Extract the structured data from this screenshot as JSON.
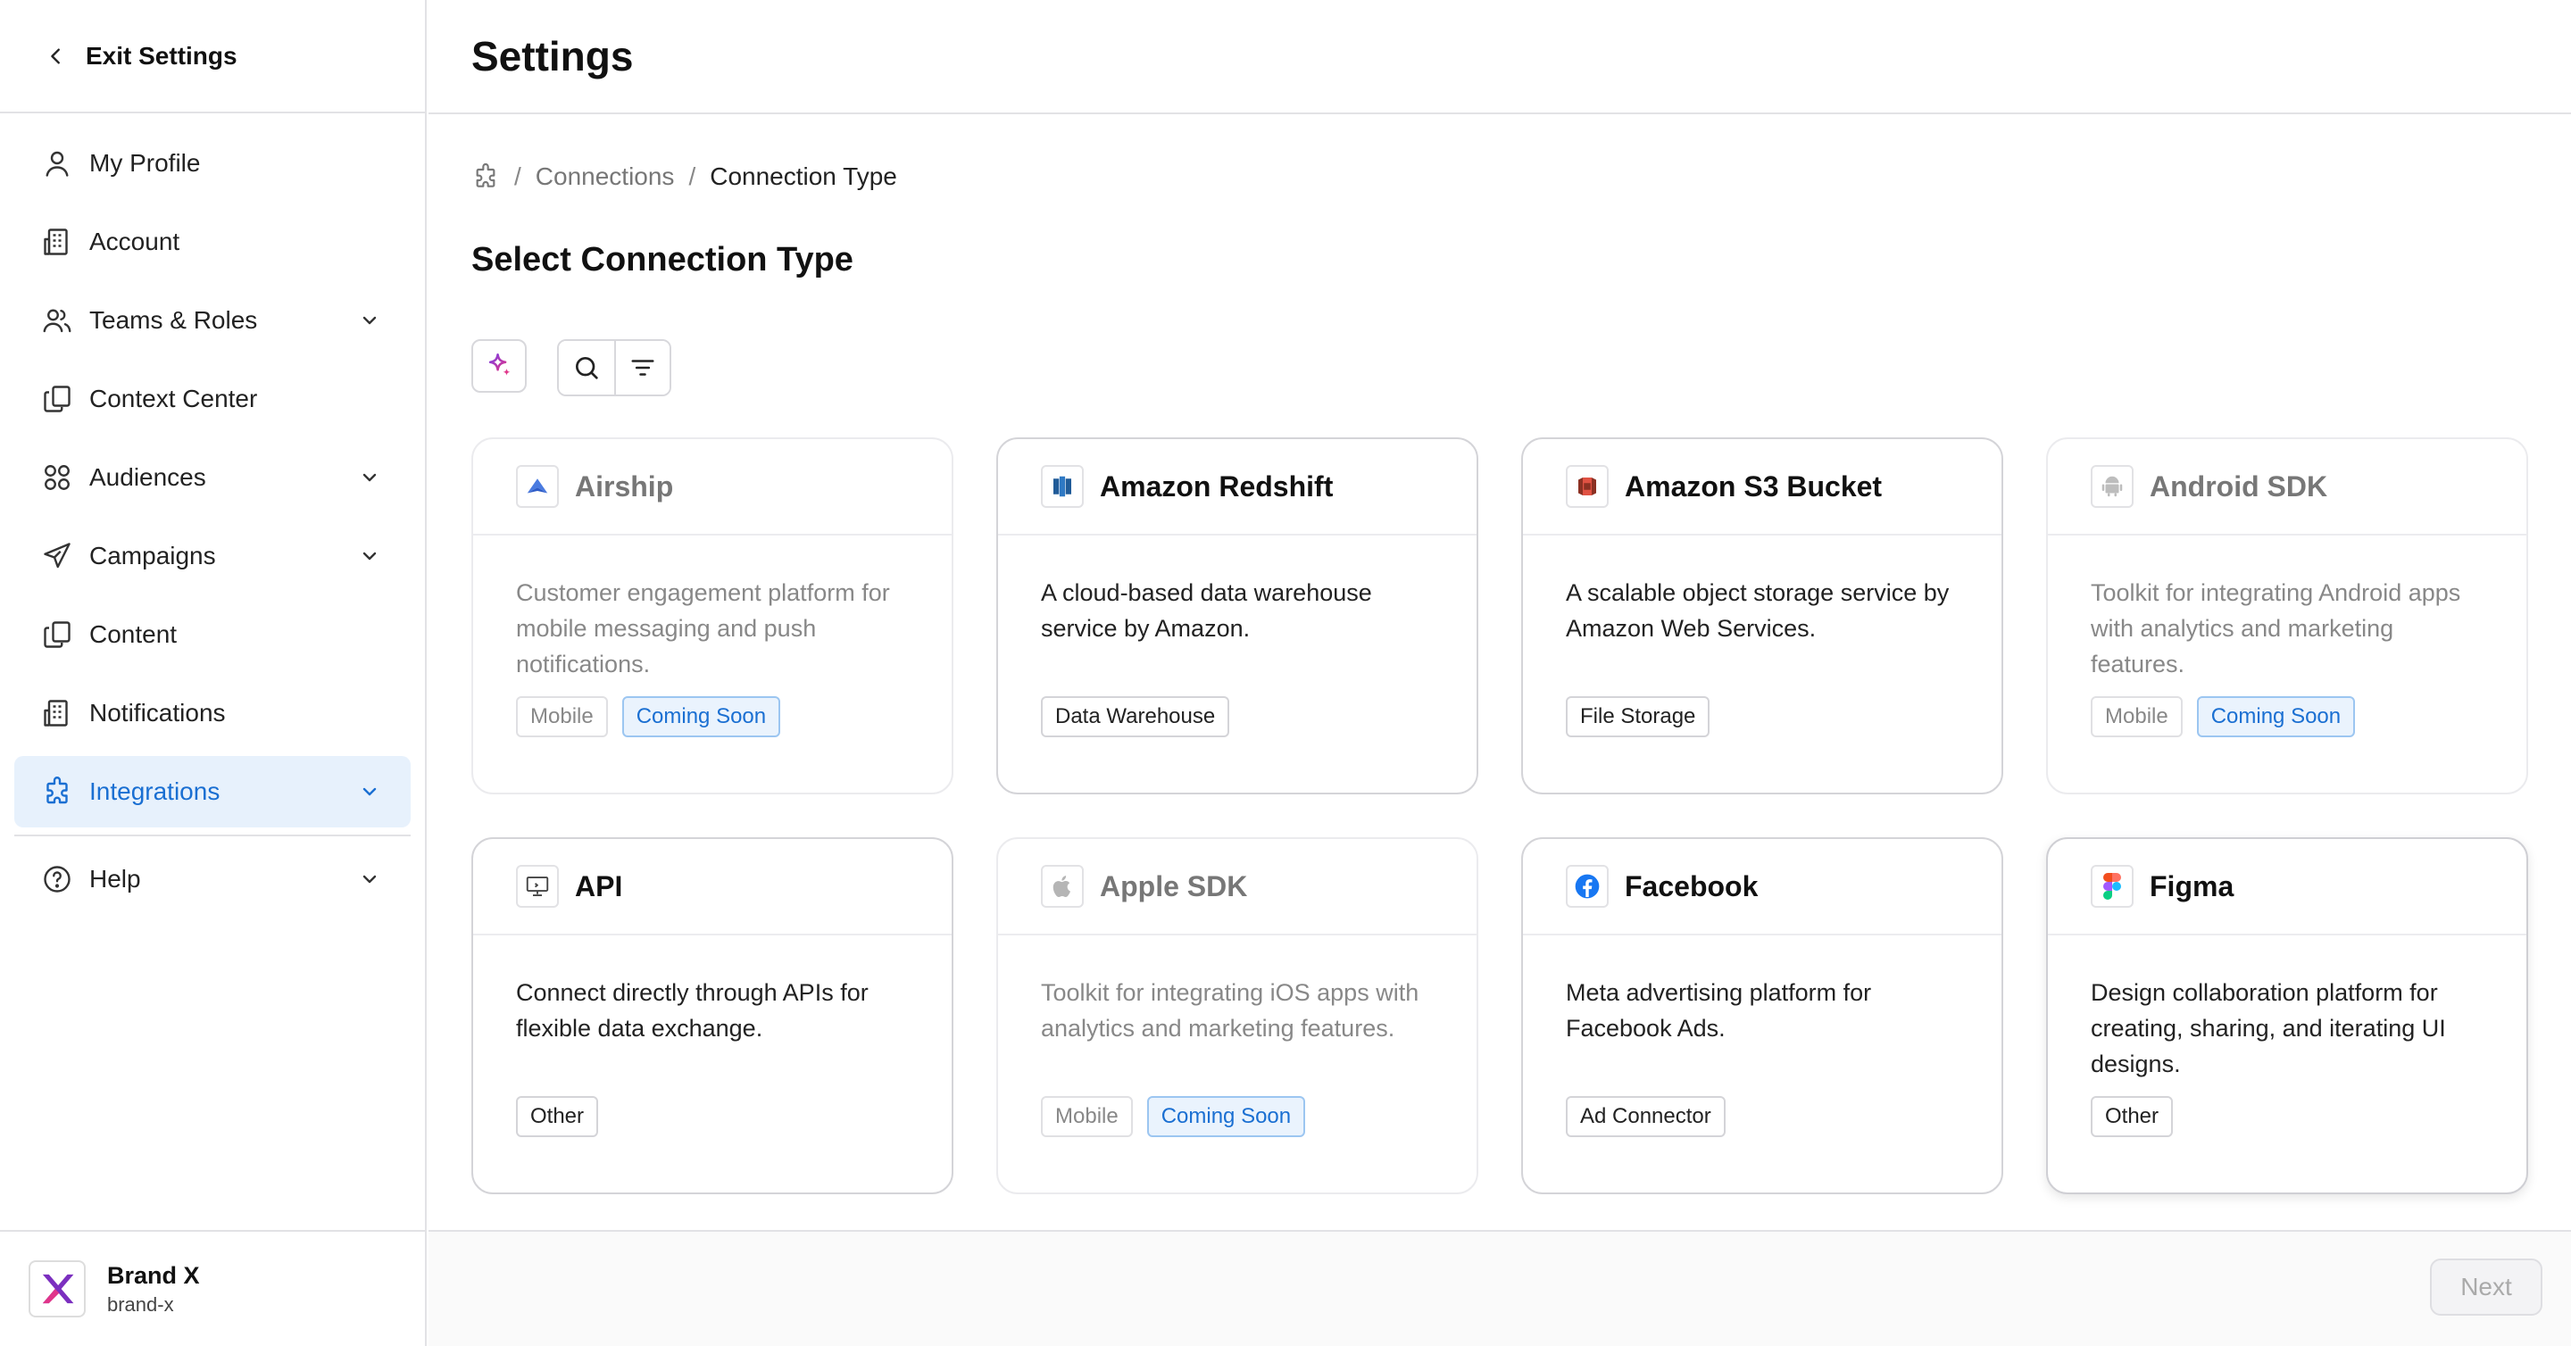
{
  "sidebar": {
    "exit_label": "Exit Settings",
    "items": [
      {
        "label": "My Profile",
        "icon": "user-icon",
        "has_chevron": false,
        "active": false
      },
      {
        "label": "Account",
        "icon": "building-icon",
        "has_chevron": false,
        "active": false
      },
      {
        "label": "Teams & Roles",
        "icon": "users-icon",
        "has_chevron": true,
        "active": false
      },
      {
        "label": "Context Center",
        "icon": "copy-icon",
        "has_chevron": false,
        "active": false
      },
      {
        "label": "Audiences",
        "icon": "audiences-icon",
        "has_chevron": true,
        "active": false
      },
      {
        "label": "Campaigns",
        "icon": "send-icon",
        "has_chevron": true,
        "active": false
      },
      {
        "label": "Content",
        "icon": "copy-icon",
        "has_chevron": false,
        "active": false
      },
      {
        "label": "Notifications",
        "icon": "building-icon",
        "has_chevron": false,
        "active": false
      },
      {
        "label": "Integrations",
        "icon": "puzzle-icon",
        "has_chevron": true,
        "active": true
      }
    ],
    "help_label": "Help",
    "brand": {
      "name": "Brand X",
      "handle": "brand-x"
    }
  },
  "header": {
    "title": "Settings"
  },
  "breadcrumb": {
    "home_icon": "puzzle-icon",
    "items": [
      "Connections",
      "Connection Type"
    ],
    "separator": "/"
  },
  "section_title": "Select Connection Type",
  "toolbar": {
    "ai_icon": "sparkle-icon",
    "search_icon": "search-icon",
    "filter_icon": "filter-icon"
  },
  "cards": [
    {
      "title": "Airship",
      "desc": "Customer engagement platform for mobile messaging and push notifications.",
      "tags": [
        "Mobile",
        "Coming Soon"
      ],
      "logo": "airship-logo",
      "disabled": true
    },
    {
      "title": "Amazon Redshift",
      "desc": "A cloud-based data warehouse service by Amazon.",
      "tags": [
        "Data Warehouse"
      ],
      "logo": "redshift-logo",
      "disabled": false
    },
    {
      "title": "Amazon S3 Bucket",
      "desc": "A scalable object storage service by Amazon Web Services.",
      "tags": [
        "File Storage"
      ],
      "logo": "s3-logo",
      "disabled": false
    },
    {
      "title": "Android SDK",
      "desc": "Toolkit for integrating Android apps with analytics and marketing features.",
      "tags": [
        "Mobile",
        "Coming Soon"
      ],
      "logo": "android-logo",
      "disabled": true
    },
    {
      "title": "API",
      "desc": "Connect directly through APIs for flexible data exchange.",
      "tags": [
        "Other"
      ],
      "logo": "api-logo",
      "disabled": false
    },
    {
      "title": "Apple SDK",
      "desc": "Toolkit for integrating iOS apps with analytics and marketing features.",
      "tags": [
        "Mobile",
        "Coming Soon"
      ],
      "logo": "apple-logo",
      "disabled": true
    },
    {
      "title": "Facebook",
      "desc": "Meta advertising platform for Facebook Ads.",
      "tags": [
        "Ad Connector"
      ],
      "logo": "facebook-logo",
      "disabled": false
    },
    {
      "title": "Figma",
      "desc": "Design collaboration platform for creating, sharing, and iterating UI designs.",
      "tags": [
        "Other"
      ],
      "logo": "figma-logo",
      "disabled": false
    }
  ],
  "footer": {
    "next_label": "Next"
  },
  "colors": {
    "accent": "#1a6fd2",
    "active_bg": "#e7f1fc",
    "border": "#d4d4d8"
  }
}
